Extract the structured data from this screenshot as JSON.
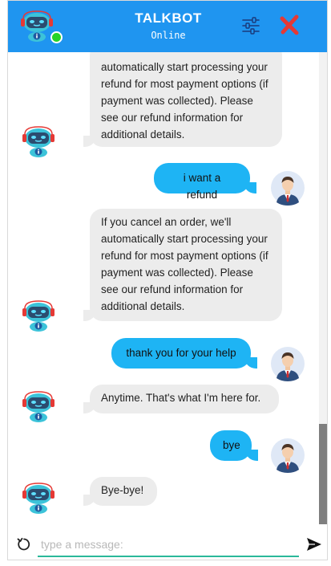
{
  "header": {
    "title": "TALKBOT",
    "status": "Online",
    "bot_avatar_icon": "robot-icon",
    "settings_icon": "sliders-icon",
    "close_icon": "close-x-icon",
    "colors": {
      "header_bg": "#1f95f0",
      "online": "#27d427",
      "close": "#e53935"
    }
  },
  "messages": [
    {
      "from": "bot",
      "text": "automatically start processing your refund for most payment options (if payment was collected). Please see our refund information for additional details."
    },
    {
      "from": "user",
      "text": "i want a refund"
    },
    {
      "from": "bot",
      "text": "If you cancel an order, we'll automatically start processing your refund for most payment options (if payment was collected). Please see our refund information for additional details."
    },
    {
      "from": "user",
      "text": "thank you for your help"
    },
    {
      "from": "bot",
      "text": "Anytime. That's what I'm here for."
    },
    {
      "from": "user",
      "text": "bye"
    },
    {
      "from": "bot",
      "text": "Bye-bye!"
    }
  ],
  "input": {
    "placeholder": "type a message:",
    "value": "",
    "reset_icon": "reload-icon",
    "send_icon": "send-icon"
  },
  "colors": {
    "bot_bubble": "#ececec",
    "user_bubble": "#1eb4f4",
    "input_underline": "#2bb89a"
  }
}
